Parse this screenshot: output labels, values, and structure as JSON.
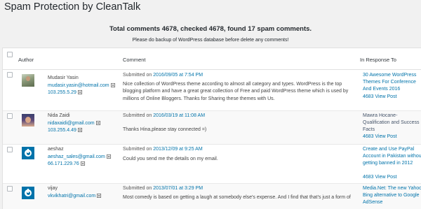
{
  "page": {
    "title": "Spam Protection by CleanTalk",
    "summary": "Total comments 4678, checked 4678, found 17 spam comments.",
    "backup_note": "Please do backup of WordPress database before delete any comments!"
  },
  "table": {
    "headers": {
      "author": "Author",
      "comment": "Comment",
      "in_response_to": "In Response To"
    },
    "rows": [
      {
        "author": "Mudasir Yasin",
        "email": "mudasir.yasin@hotmail.com",
        "ip": "103.255.5.29",
        "avatar": "user-photo",
        "submitted_prefix": "Submitted on",
        "submitted_date": "2016/09/05 at 7:54 PM",
        "comment": "Nice collection of WordPress theme according to almost all category and types. WordPress is the top blogging platform and have a great great collection of Free and paid WordPress theme which is used by millions of Online Bloggers. Thanks for Sharing these themes with Us.",
        "response_title": "30 Awesome WordPress Themes For Conference And Events 2016",
        "response_count": "4683 View Post"
      },
      {
        "author": "Nida Zaidi",
        "email": "nidaxaidi@gmail.com",
        "ip": "103.255.4.49",
        "avatar": "user-photo",
        "submitted_prefix": "Submitted on",
        "submitted_date": "2016/03/19 at 11:08 AM",
        "comment": "Thanks Hina,please stay connected =)",
        "response_title": "Mawra Hocane- Qualification and Success Facts",
        "response_count": "4683 View Post"
      },
      {
        "author": "aeshaz",
        "email": "aeshaz_sales@gmail.com",
        "ip": "66.171.229.76",
        "avatar": "wordpress-logo-icon",
        "submitted_prefix": "Submitted on",
        "submitted_date": "2013/12/09 at 9:25 AM",
        "comment": "Could you send me the details on my email.",
        "response_title": "Create and Use PayPal Account in Pakistan without getting banned in 2012",
        "response_count": "4683 View Post"
      },
      {
        "author": "vijay",
        "email": "vkvikhatri@gmail.com",
        "ip": "",
        "avatar": "wordpress-logo-icon",
        "submitted_prefix": "Submitted on",
        "submitted_date": "2013/07/01 at 3:29 PM",
        "comment": "Most comedy is based on getting a laugh at somebody else's expense. And I find that that's just a form of",
        "response_title": "Media.Net: The new Yahoo! Bing alternative to Google AdSense",
        "response_count": ""
      }
    ]
  },
  "colors": {
    "link": "#0073aa",
    "text": "#444444",
    "background": "#f1f1f1",
    "avatar_blue": "#0073aa"
  }
}
